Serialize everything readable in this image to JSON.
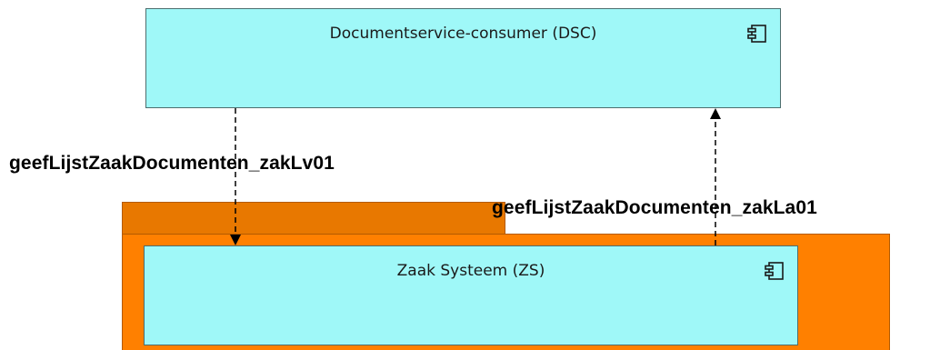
{
  "diagram": {
    "package": {
      "colors": {
        "tab": "#e87800",
        "body": "#ff8000"
      }
    },
    "components": [
      {
        "id": "dsc",
        "label": "Documentservice-consumer (DSC)",
        "icon": "component-icon",
        "color": "#9ff8f8"
      },
      {
        "id": "zs",
        "label": "Zaak Systeem (ZS)",
        "icon": "component-icon",
        "color": "#9ff8f8"
      }
    ],
    "connections": [
      {
        "from": "dsc",
        "to": "zs",
        "label": "geefLijstZaakDocumenten_zakLv01",
        "style": "dashed"
      },
      {
        "from": "zs",
        "to": "dsc",
        "label": "geefLijstZaakDocumenten_zakLa01",
        "style": "dashed"
      }
    ]
  }
}
